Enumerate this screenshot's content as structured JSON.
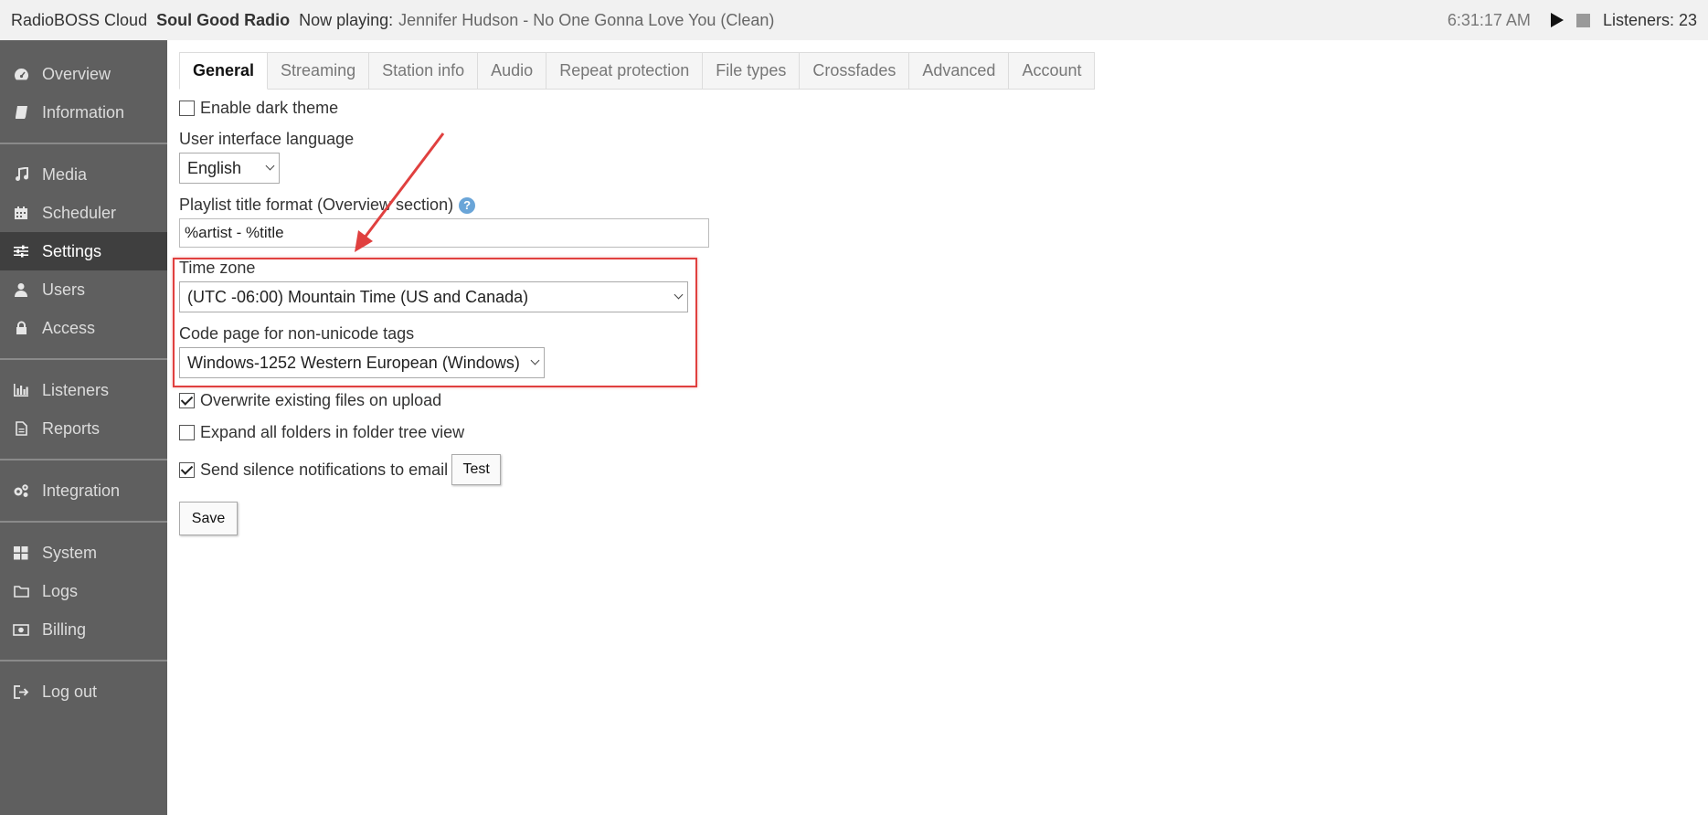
{
  "topbar": {
    "app_name": "RadioBOSS Cloud",
    "station": "Soul Good Radio",
    "now_playing_label": "Now playing:",
    "now_playing_track": "Jennifer Hudson - No One Gonna Love You (Clean)",
    "clock": "6:31:17 AM",
    "listeners": "Listeners: 23"
  },
  "sidebar": {
    "items": [
      {
        "label": "Overview",
        "icon": "dashboard-icon"
      },
      {
        "label": "Information",
        "icon": "book-icon"
      },
      {
        "label": "Media",
        "icon": "music-icon"
      },
      {
        "label": "Scheduler",
        "icon": "calendar-icon"
      },
      {
        "label": "Settings",
        "icon": "sliders-icon"
      },
      {
        "label": "Users",
        "icon": "user-icon"
      },
      {
        "label": "Access",
        "icon": "lock-icon"
      },
      {
        "label": "Listeners",
        "icon": "bar-chart-icon"
      },
      {
        "label": "Reports",
        "icon": "file-icon"
      },
      {
        "label": "Integration",
        "icon": "gears-icon"
      },
      {
        "label": "System",
        "icon": "grid-icon"
      },
      {
        "label": "Logs",
        "icon": "folder-icon"
      },
      {
        "label": "Billing",
        "icon": "money-icon"
      },
      {
        "label": "Log out",
        "icon": "logout-icon"
      }
    ],
    "active": "Settings"
  },
  "tabs": [
    "General",
    "Streaming",
    "Station info",
    "Audio",
    "Repeat protection",
    "File types",
    "Crossfades",
    "Advanced",
    "Account"
  ],
  "form": {
    "dark_theme_label": "Enable dark theme",
    "dark_theme_checked": false,
    "language_label": "User interface language",
    "language_value": "English",
    "playlist_format_label": "Playlist title format (Overview section)",
    "playlist_format_value": "%artist - %title",
    "help_glyph": "?",
    "timezone_label": "Time zone",
    "timezone_value": "(UTC -06:00) Mountain Time (US and Canada)",
    "codepage_label": "Code page for non-unicode tags",
    "codepage_value": "Windows-1252 Western European (Windows)",
    "overwrite_label": "Overwrite existing files on upload",
    "overwrite_checked": true,
    "expand_label": "Expand all folders in folder tree view",
    "expand_checked": false,
    "silence_label": "Send silence notifications to email",
    "silence_checked": true,
    "test_button": "Test",
    "save_button": "Save"
  },
  "colors": {
    "sidebar_bg": "#5f5f5f",
    "sidebar_active": "#3f3f3f",
    "topbar_bg": "#f1f1f1",
    "annotation_red": "#e0403f",
    "help_blue": "#6aa5d8"
  }
}
